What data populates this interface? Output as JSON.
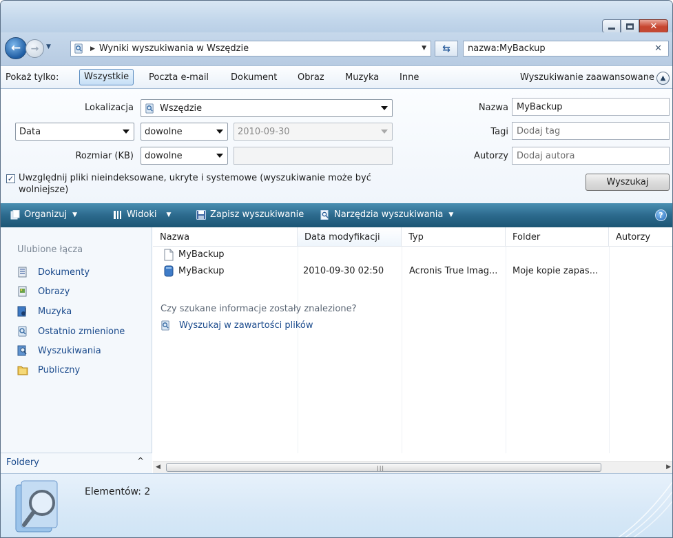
{
  "window": {
    "controls": {
      "minimize": "minimize-icon",
      "maximize": "maximize-icon",
      "close": "close-icon"
    }
  },
  "address": {
    "path": "Wyniki wyszukiwania w Wszędzie",
    "search_value": "nazwa:MyBackup"
  },
  "filter": {
    "label": "Pokaż tylko:",
    "tabs": [
      "Wszystkie",
      "Poczta e-mail",
      "Dokument",
      "Obraz",
      "Muzyka",
      "Inne"
    ],
    "active_tab": "Wszystkie",
    "advanced_label": "Wyszukiwanie zaawansowane"
  },
  "advanced": {
    "location_label": "Lokalizacja",
    "location_value": "Wszędzie",
    "date_field": "Data",
    "date_operator": "dowolne",
    "date_value": "2010-09-30",
    "size_label": "Rozmiar (KB)",
    "size_operator": "dowolne",
    "size_value": "",
    "name_label": "Nazwa",
    "name_value": "MyBackup",
    "tags_label": "Tagi",
    "tags_placeholder": "Dodaj tag",
    "authors_label": "Autorzy",
    "authors_placeholder": "Dodaj autora",
    "include_checkbox_checked": true,
    "include_checkbox_label": "Uwzględnij pliki nieindeksowane, ukryte i systemowe (wyszukiwanie może być wolniejsze)",
    "search_button": "Wyszukaj"
  },
  "toolbar": {
    "organize": "Organizuj",
    "views": "Widoki",
    "save_search": "Zapisz wyszukiwanie",
    "search_tools": "Narzędzia wyszukiwania"
  },
  "nav": {
    "favorites_header": "Ulubione łącza",
    "items": [
      "Dokumenty",
      "Obrazy",
      "Muzyka",
      "Ostatnio zmienione",
      "Wyszukiwania",
      "Publiczny"
    ],
    "folders_label": "Foldery"
  },
  "files": {
    "columns": [
      "Nazwa",
      "Data modyfikacji",
      "Typ",
      "Folder",
      "Autorzy"
    ],
    "rows": [
      {
        "name": "MyBackup",
        "date": "",
        "type": "",
        "folder": "",
        "icon": "blank-file-icon"
      },
      {
        "name": "MyBackup",
        "date": "2010-09-30 02:50",
        "type": "Acronis True Imag...",
        "folder": "Moje kopie zapas...",
        "icon": "backup-archive-icon"
      }
    ],
    "not_found_prompt": "Czy szukane informacje zostały znalezione?",
    "search_contents_link": "Wyszukaj w zawartości plików"
  },
  "details": {
    "count_text": "Elementów: 2"
  },
  "colors": {
    "toolbar": "#2c6a8d",
    "link": "#1a4a8c",
    "close_button": "#c7452f"
  }
}
